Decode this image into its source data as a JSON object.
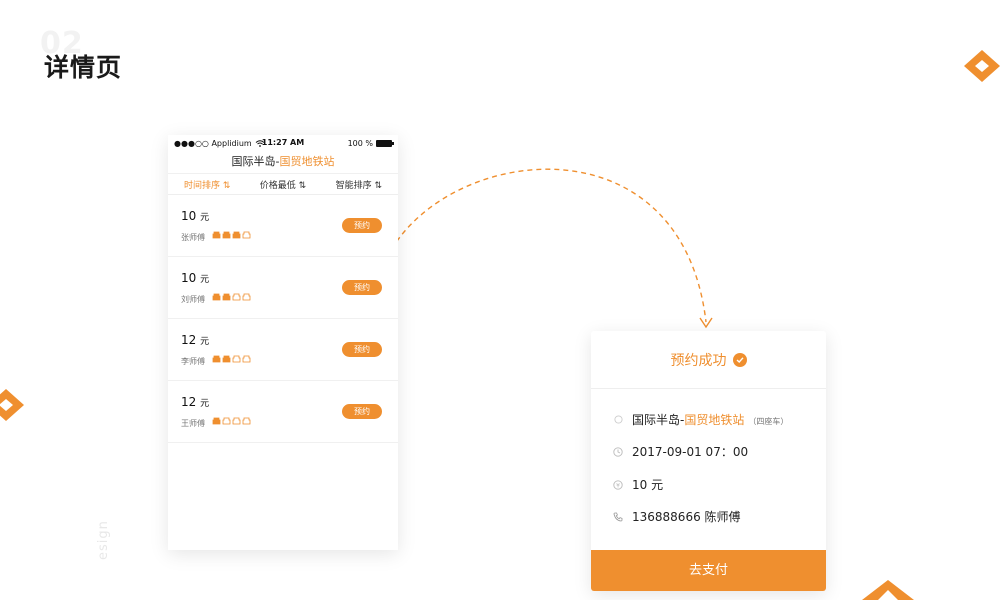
{
  "page": {
    "bg_number": "02",
    "title": "详情页",
    "side_text": "esign"
  },
  "phone": {
    "status": {
      "carrier": "●●●○○ Applidium",
      "time": "11:27 AM",
      "battery": "100 %"
    },
    "nav": {
      "title_main": "国际半岛-",
      "title_highlight": "国贸地铁站"
    },
    "sort_tabs": [
      {
        "label": "时间排序 ⇅",
        "active": true
      },
      {
        "label": "价格最低 ⇅",
        "active": false
      },
      {
        "label": "智能排序 ⇅",
        "active": false
      }
    ],
    "drivers": [
      {
        "price": "10",
        "unit": "元",
        "name": "张师傅",
        "seats_taken": 3,
        "seats_total": 4,
        "button": "预约"
      },
      {
        "price": "10",
        "unit": "元",
        "name": "刘师傅",
        "seats_taken": 2,
        "seats_total": 4,
        "button": "预约"
      },
      {
        "price": "12",
        "unit": "元",
        "name": "李师傅",
        "seats_taken": 2,
        "seats_total": 4,
        "button": "预约"
      },
      {
        "price": "12",
        "unit": "元",
        "name": "王师傅",
        "seats_taken": 1,
        "seats_total": 4,
        "button": "预约"
      }
    ]
  },
  "card": {
    "title": "预约成功",
    "route_main": "国际半岛-",
    "route_highlight": "国贸地铁站",
    "car_type": "（四座车）",
    "datetime": "2017-09-01  07：00",
    "price": "10 元",
    "contact": "136888666  陈师傅",
    "pay_button": "去支付"
  },
  "colors": {
    "accent": "#ef8f2f"
  },
  "icons": [
    "location-icon",
    "clock-icon",
    "yen-icon",
    "phone-icon",
    "check-icon",
    "seat-icon",
    "wifi-icon",
    "battery-icon",
    "diamond-decoration"
  ]
}
